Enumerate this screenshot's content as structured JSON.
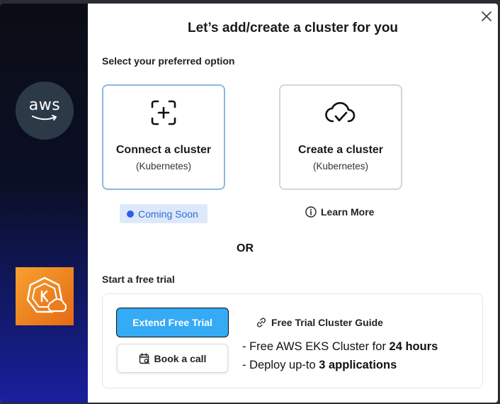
{
  "title": "Let’s add/create a cluster for you",
  "select_label": "Select your preferred option",
  "sidebar": {
    "aws_logo_text": "aws"
  },
  "options": [
    {
      "name": "Connect a cluster",
      "sub": "(Kubernetes)",
      "icon": "add-square-icon"
    },
    {
      "name": "Create a cluster",
      "sub": "(Kubernetes)",
      "icon": "cloud-check-icon"
    }
  ],
  "coming_soon": "Coming Soon",
  "learn_more": "Learn More",
  "or_text": "OR",
  "trial_label": "Start a free trial",
  "buttons": {
    "extend_trial": "Extend Free Trial",
    "book_call": "Book a call"
  },
  "guide_link": "Free Trial Cluster Guide",
  "features": [
    {
      "prefix": "- Free AWS EKS Cluster for ",
      "bold": "24 hours"
    },
    {
      "prefix": "- Deploy up-to ",
      "bold": "3 applications"
    }
  ],
  "colors": {
    "primary": "#35aaf5",
    "selected_border": "#8fb6e6",
    "badge_bg": "#dde9fb",
    "badge_text": "#2f6bd6"
  }
}
